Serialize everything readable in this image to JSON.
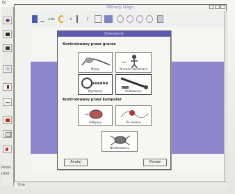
{
  "window": {
    "title": "Obrazy ciagu"
  },
  "left_edge": {
    "top_label": "Ep",
    "labels": [
      "Rrzes",
      "Uhdr"
    ],
    "bottom_label": "Urw"
  },
  "toolbar": {
    "items": [
      "wide",
      "6",
      "5"
    ]
  },
  "dialog": {
    "title": "Sterowanie",
    "section_player": "Kontrolowany przez gracza",
    "options_player": [
      {
        "label": "Myszy",
        "icon": "mouse-icon"
      },
      {
        "label": "W stosie dorownach",
        "icon": "person-icon"
      },
      {
        "label": "Wykrojony",
        "icon": "wheel-chain-icon"
      },
      {
        "label": "Pozbawiony",
        "icon": "conveyor-icon"
      }
    ],
    "section_computer": "Kontrolowany przez komputer",
    "options_computer": [
      {
        "label": "Odbijany",
        "icon": "barrel-icon"
      },
      {
        "label": "Po sciezce",
        "icon": "path-icon"
      },
      {
        "label": "Niesterowany",
        "icon": "crab-icon"
      }
    ],
    "cancel_label": "Anuluj",
    "ok_label": "Ponow"
  },
  "colors": {
    "dialog_title_bg": "#5f59b6",
    "canvas": "#8b86ce"
  }
}
